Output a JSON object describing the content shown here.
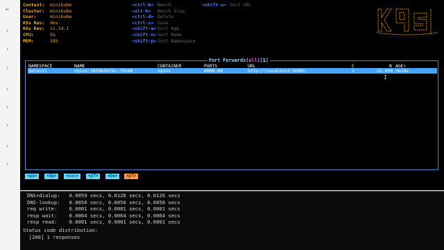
{
  "header": {
    "info": [
      {
        "key": "Context:",
        "value": "minikube"
      },
      {
        "key": "Cluster:",
        "value": "minikube"
      },
      {
        "key": "User:",
        "value": "minikube"
      },
      {
        "key": "K9s Rev:",
        "value": "dev"
      },
      {
        "key": "K8s Rev:",
        "value": "v1.14.1"
      },
      {
        "key": "CPU:",
        "value": "5%"
      },
      {
        "key": "MEM:",
        "value": "18%"
      }
    ],
    "shortcuts_left": [
      {
        "key": "<ctrl-b>",
        "label": "Bench"
      },
      {
        "key": "<alt-b>",
        "label": "Bench Stop"
      },
      {
        "key": "<ctrl-d>",
        "label": "Delete"
      },
      {
        "key": "<ctrl-s>",
        "label": "Save"
      },
      {
        "key": "<shift-a>",
        "label": "Sort Age"
      },
      {
        "key": "<shift-n>",
        "label": "Sort Name"
      },
      {
        "key": "<shift-p>",
        "label": "Sort Namespace"
      }
    ],
    "shortcuts_right": [
      {
        "key": "<shift-u>",
        "label": "Sort URL"
      }
    ]
  },
  "panel": {
    "title_main": "Port Forwards(",
    "title_filter": "all",
    "title_close": ")[",
    "title_count": "1",
    "title_end": "]",
    "columns": [
      "NAMESPACE",
      "NAME",
      "CONTAINER",
      "PORTS",
      "URL",
      "C",
      "N",
      "AGE↑"
    ],
    "rows": [
      {
        "namespace": "default",
        "name": "nginx-78f8b5d78c-f8588",
        "container": "nginx",
        "ports": "8080:80",
        "url": "http://localhost:8080/",
        "c": "2",
        "n": "15,000",
        "age": "3m19s"
      }
    ]
  },
  "breadcrumbs": [
    "<po>",
    "<dp>",
    "<svc>",
    "<pf>",
    "<be>",
    "<pf>"
  ],
  "active_breadcrumb": 5,
  "output": {
    "lines": [
      "DNS+dialup:   0.0059 secs, 0.0126 secs, 0.0126 secs",
      "DNS-lookup:   0.0050 secs, 0.0050 secs, 0.0050 secs",
      "req write:    0.0001 secs, 0.0001 secs, 0.0001 secs",
      "resp wait:    0.0064 secs, 0.0064 secs, 0.0064 secs",
      "resp read:    0.0001 secs, 0.0001 secs, 0.0001 secs",
      "",
      "Status code distribution:",
      "  [200] 1 responses"
    ]
  }
}
